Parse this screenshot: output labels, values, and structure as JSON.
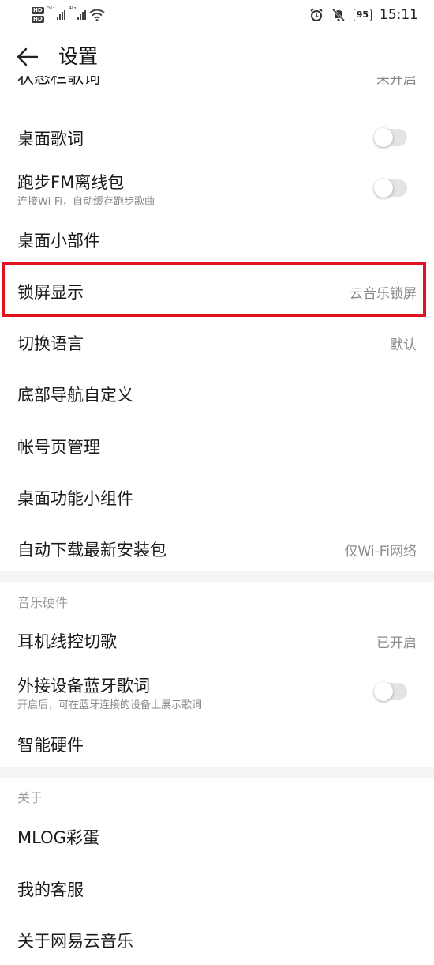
{
  "status_bar": {
    "hd1": "HD",
    "hd2": "HD",
    "net1": "5G",
    "net2": "4G",
    "battery": "95",
    "time": "15:11"
  },
  "header": {
    "title": "设置"
  },
  "rows": {
    "status_lyrics": {
      "label": "状态栏歌词",
      "value": "未开启"
    },
    "desktop_lyrics": {
      "label": "桌面歌词",
      "toggle_on": false
    },
    "run_fm": {
      "label": "跑步FM离线包",
      "sub": "连接Wi-Fi，自动缓存跑步歌曲",
      "toggle_on": false
    },
    "desktop_widget": {
      "label": "桌面小部件"
    },
    "lock_screen": {
      "label": "锁屏显示",
      "value": "云音乐锁屏"
    },
    "language": {
      "label": "切换语言",
      "value": "默认"
    },
    "bottom_nav": {
      "label": "底部导航自定义"
    },
    "account_page": {
      "label": "帐号页管理"
    },
    "desktop_func_widget": {
      "label": "桌面功能小组件"
    },
    "auto_download": {
      "label": "自动下载最新安装包",
      "value": "仅Wi-Fi网络"
    }
  },
  "section_hardware": {
    "header": "音乐硬件",
    "earphone": {
      "label": "耳机线控切歌",
      "value": "已开启"
    },
    "bt_lyrics": {
      "label": "外接设备蓝牙歌词",
      "sub": "开启后，可在蓝牙连接的设备上展示歌词",
      "toggle_on": false
    },
    "smart_hw": {
      "label": "智能硬件"
    }
  },
  "section_about": {
    "header": "关于",
    "mlog": {
      "label": "MLOG彩蛋"
    },
    "support": {
      "label": "我的客服"
    },
    "about_app": {
      "label": "关于网易云音乐"
    }
  },
  "colors": {
    "highlight": "#e0121f",
    "band": "#f4f4f4"
  }
}
